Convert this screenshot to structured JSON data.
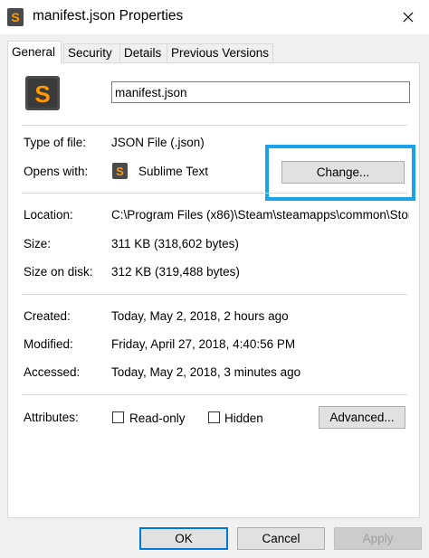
{
  "window": {
    "title": "manifest.json Properties"
  },
  "tabs": [
    {
      "label": "General",
      "active": true
    },
    {
      "label": "Security",
      "active": false
    },
    {
      "label": "Details",
      "active": false
    },
    {
      "label": "Previous Versions",
      "active": false
    }
  ],
  "file": {
    "name": "manifest.json",
    "icon": "sublime-text-icon"
  },
  "type": {
    "label": "Type of file:",
    "value": "JSON File (.json)"
  },
  "opens_with": {
    "label": "Opens with:",
    "value": "Sublime Text",
    "change_label": "Change..."
  },
  "location": {
    "label": "Location:",
    "value": "C:\\Program Files (x86)\\Steam\\steamapps\\common\\Stor"
  },
  "size": {
    "label": "Size:",
    "value": "311 KB (318,602 bytes)"
  },
  "size_on_disk": {
    "label": "Size on disk:",
    "value": "312 KB (319,488 bytes)"
  },
  "created": {
    "label": "Created:",
    "value": "Today, May 2, 2018, 2 hours ago"
  },
  "modified": {
    "label": "Modified:",
    "value": "Friday, April 27, 2018, 4:40:56 PM"
  },
  "accessed": {
    "label": "Accessed:",
    "value": "Today, May 2, 2018, 3 minutes ago"
  },
  "attributes": {
    "label": "Attributes:",
    "read_only_label": "Read-only",
    "read_only_checked": false,
    "hidden_label": "Hidden",
    "hidden_checked": false,
    "advanced_label": "Advanced..."
  },
  "footer": {
    "ok_label": "OK",
    "cancel_label": "Cancel",
    "apply_label": "Apply"
  },
  "colors": {
    "highlight": "#1aa3e8",
    "default_button_border": "#0078d7",
    "sublime_orange": "#ff9800",
    "icon_dark": "#4a4a4a"
  }
}
